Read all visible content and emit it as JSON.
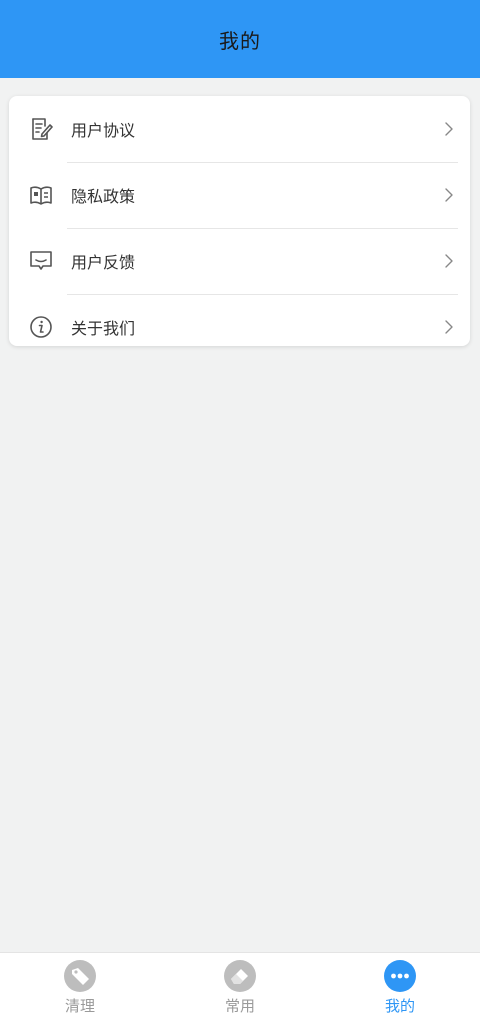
{
  "header": {
    "title": "我的"
  },
  "menu": {
    "items": [
      {
        "label": "用户协议",
        "icon": "document-edit-icon"
      },
      {
        "label": "隐私政策",
        "icon": "book-icon"
      },
      {
        "label": "用户反馈",
        "icon": "feedback-icon"
      },
      {
        "label": "关于我们",
        "icon": "info-icon"
      }
    ],
    "chevron_icon": "chevron-right-icon"
  },
  "tabbar": {
    "tabs": [
      {
        "label": "清理",
        "icon": "tag-icon",
        "active": false
      },
      {
        "label": "常用",
        "icon": "eraser-icon",
        "active": false
      },
      {
        "label": "我的",
        "icon": "more-dots-icon",
        "active": true
      }
    ]
  },
  "colors": {
    "accent": "#2e96f5",
    "background": "#f1f2f2",
    "inactive_tab": "#9a9a9a",
    "text": "#333333"
  }
}
